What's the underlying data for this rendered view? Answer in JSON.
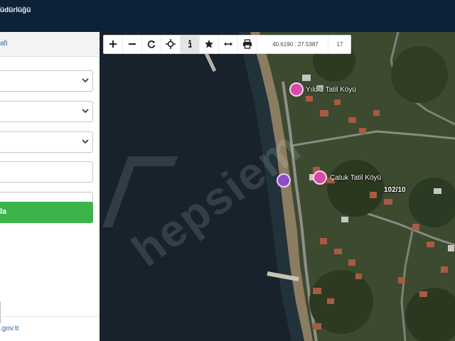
{
  "header": {
    "title": "üdürlüğü"
  },
  "sidebar": {
    "header_label": "afi",
    "search_button_label": "la",
    "footer_text": ".gov.tr"
  },
  "toolbar": {
    "coordinates": "40.6190 : 27.5387",
    "zoom": "17"
  },
  "map": {
    "markers": [
      {
        "label": "Yıldız Tatil Köyü"
      },
      {
        "label": "Çatuk Tatil Köyü"
      }
    ],
    "parcel_label": "102/10",
    "watermark": "hepsiem"
  },
  "colors": {
    "header_bg": "#0d2238",
    "accent_green": "#3cb44a",
    "marker_pink": "#d94aa8",
    "sea": "#16212b"
  }
}
